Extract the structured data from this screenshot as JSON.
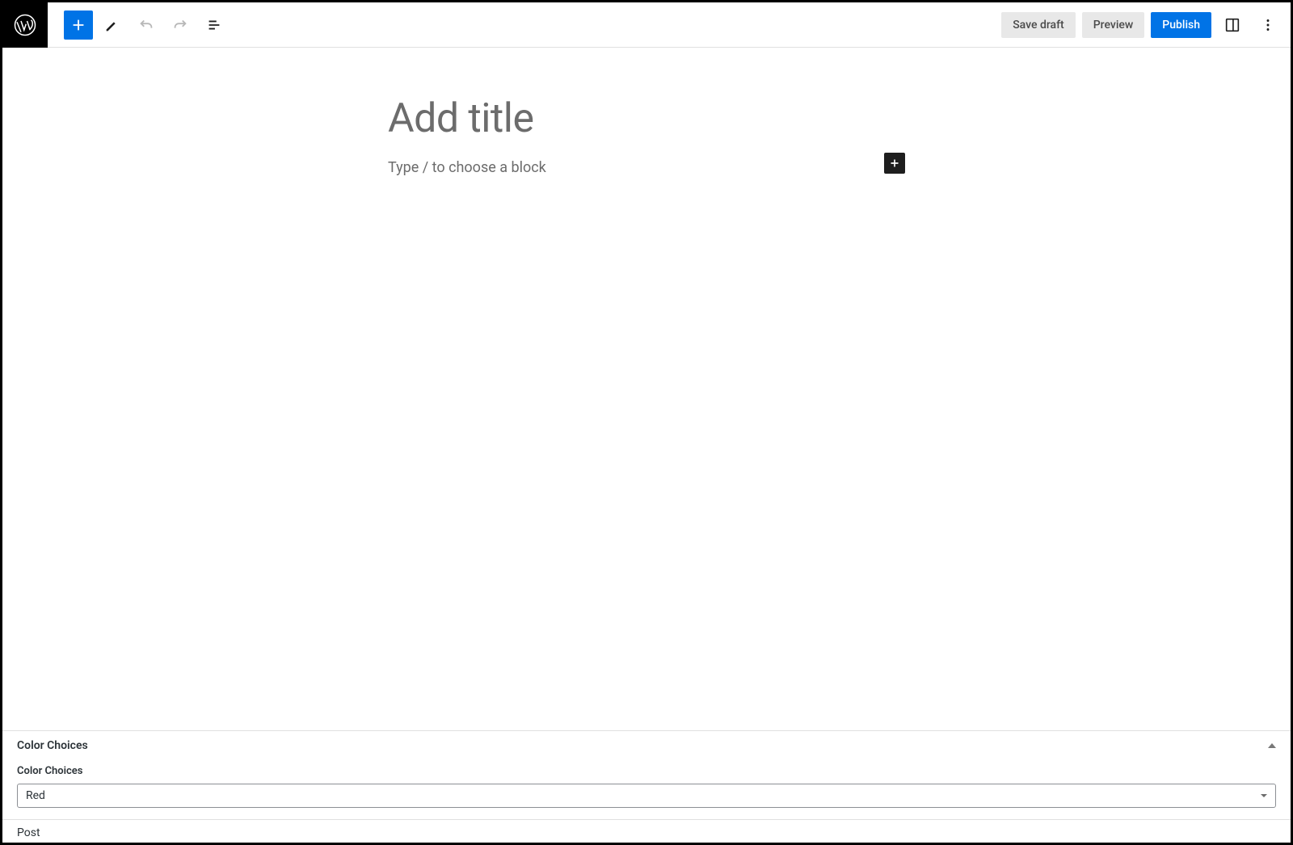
{
  "toolbar": {
    "save_draft": "Save draft",
    "preview": "Preview",
    "publish": "Publish"
  },
  "editor": {
    "title_placeholder": "Add title",
    "block_placeholder": "Type / to choose a block"
  },
  "metabox": {
    "heading": "Color Choices",
    "field_label": "Color Choices",
    "selected_value": "Red"
  },
  "footer": {
    "post_type": "Post"
  },
  "colors": {
    "primary": "#0073e6",
    "toolbar_bg": "#ffffff"
  }
}
